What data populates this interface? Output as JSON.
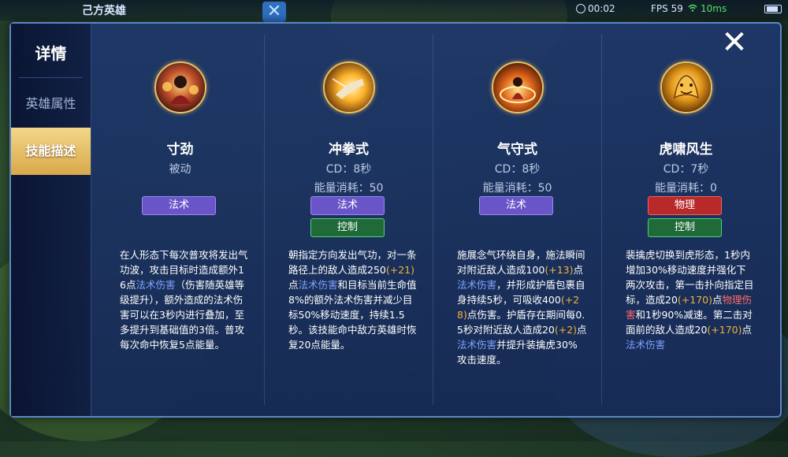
{
  "background": {
    "top_title": "己方英雄",
    "clock": "00:02",
    "fps": "FPS 59",
    "ping": "10ms"
  },
  "panel": {
    "sidebar": {
      "title": "详情",
      "items": [
        {
          "label": "英雄属性",
          "active": false
        },
        {
          "label": "技能描述",
          "active": true
        }
      ]
    },
    "close_glyph": "✕",
    "skills": [
      {
        "name": "寸劲",
        "line2": "被动",
        "line3": "",
        "tags": [
          {
            "label": "法术",
            "kind": "magic"
          }
        ],
        "desc": [
          {
            "t": "在人形态下每次普攻将发出气功波，攻击目标时造成额外16点",
            "c": ""
          },
          {
            "t": "法术伤害",
            "c": "m"
          },
          {
            "t": "（伤害随英雄等级提升），额外造成的法术伤害可以在3秒内进行叠加，至多提升到基础值的3倍。普攻每次命中恢复5点能量。",
            "c": ""
          }
        ]
      },
      {
        "name": "冲拳式",
        "line2": "CD：8秒",
        "line3": "能量消耗：50",
        "tags": [
          {
            "label": "法术",
            "kind": "magic"
          },
          {
            "label": "控制",
            "kind": "control"
          }
        ],
        "desc": [
          {
            "t": "朝指定方向发出气功，对一条路径上的敌人造成250",
            "c": ""
          },
          {
            "t": "(+21)",
            "c": "g"
          },
          {
            "t": "点",
            "c": ""
          },
          {
            "t": "法术伤害",
            "c": "m"
          },
          {
            "t": "和目标当前生命值8%的额外法术伤害并减少目标50%移动速度，持续1.5秒。该技能命中敌方英雄时恢复20点能量。",
            "c": ""
          }
        ]
      },
      {
        "name": "气守式",
        "line2": "CD：8秒",
        "line3": "能量消耗：50",
        "tags": [
          {
            "label": "法术",
            "kind": "magic"
          }
        ],
        "desc": [
          {
            "t": "施展念气环绕自身，施法瞬间对附近敌人造成100",
            "c": ""
          },
          {
            "t": "(+13)",
            "c": "g"
          },
          {
            "t": "点",
            "c": ""
          },
          {
            "t": "法术伤害",
            "c": "m"
          },
          {
            "t": "，并形成护盾包裹自身持续5秒，可吸收400",
            "c": ""
          },
          {
            "t": "(+28)",
            "c": "g"
          },
          {
            "t": "点伤害。护盾存在期间每0.5秒对附近敌人造成20",
            "c": ""
          },
          {
            "t": "(+2)",
            "c": "g"
          },
          {
            "t": "点",
            "c": ""
          },
          {
            "t": "法术伤害",
            "c": "m"
          },
          {
            "t": "并提升装擒虎30%攻击速度。",
            "c": ""
          }
        ]
      },
      {
        "name": "虎啸风生",
        "line2": "CD：7秒",
        "line3": "能量消耗：0",
        "tags": [
          {
            "label": "物理",
            "kind": "phys"
          },
          {
            "label": "控制",
            "kind": "control"
          }
        ],
        "desc": [
          {
            "t": "裴擒虎切换到虎形态，1秒内增加30%移动速度并强化下两次攻击，第一击扑向指定目标，造成20",
            "c": ""
          },
          {
            "t": "(+170)",
            "c": "g"
          },
          {
            "t": "点",
            "c": ""
          },
          {
            "t": "物理伤害",
            "c": "p"
          },
          {
            "t": "和1秒90%减速。第二击对面前的敌人造成20",
            "c": ""
          },
          {
            "t": "(+170)",
            "c": "g"
          },
          {
            "t": "点",
            "c": ""
          },
          {
            "t": "法术伤害",
            "c": "m"
          }
        ]
      }
    ]
  }
}
